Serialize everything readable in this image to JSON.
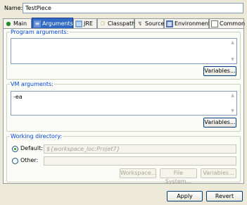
{
  "name": {
    "label": "Name:",
    "value": "TestPiece"
  },
  "tabs": [
    {
      "label": "Main",
      "icon": "main-tab-icon",
      "active": false
    },
    {
      "label": "Arguments",
      "icon": "arguments-tab-icon",
      "active": true
    },
    {
      "label": "JRE",
      "icon": "jre-tab-icon",
      "active": false
    },
    {
      "label": "Classpath",
      "icon": "classpath-tab-icon",
      "active": false
    },
    {
      "label": "Source",
      "icon": "source-tab-icon",
      "active": false
    },
    {
      "label": "Environment",
      "icon": "environment-tab-icon",
      "active": false
    },
    {
      "label": "Common",
      "icon": "common-tab-icon",
      "active": false
    }
  ],
  "program_arguments": {
    "label": "Program arguments:",
    "value": "",
    "variables_button": "Variables..."
  },
  "vm_arguments": {
    "label": "VM arguments:",
    "value": "-ea",
    "variables_button": "Variables..."
  },
  "working_directory": {
    "label": "Working directory:",
    "default_label": "Default:",
    "default_value": "${workspace_loc:Projet7}",
    "default_selected": true,
    "other_label": "Other:",
    "other_value": "",
    "buttons": {
      "workspace": "Workspace...",
      "file_system": "File System...",
      "variables": "Variables..."
    }
  },
  "footer": {
    "apply": "Apply",
    "revert": "Revert"
  },
  "colors": {
    "active_tab": "#316ac5",
    "group_label": "#0046d5",
    "window_bg": "#ece9d8"
  }
}
